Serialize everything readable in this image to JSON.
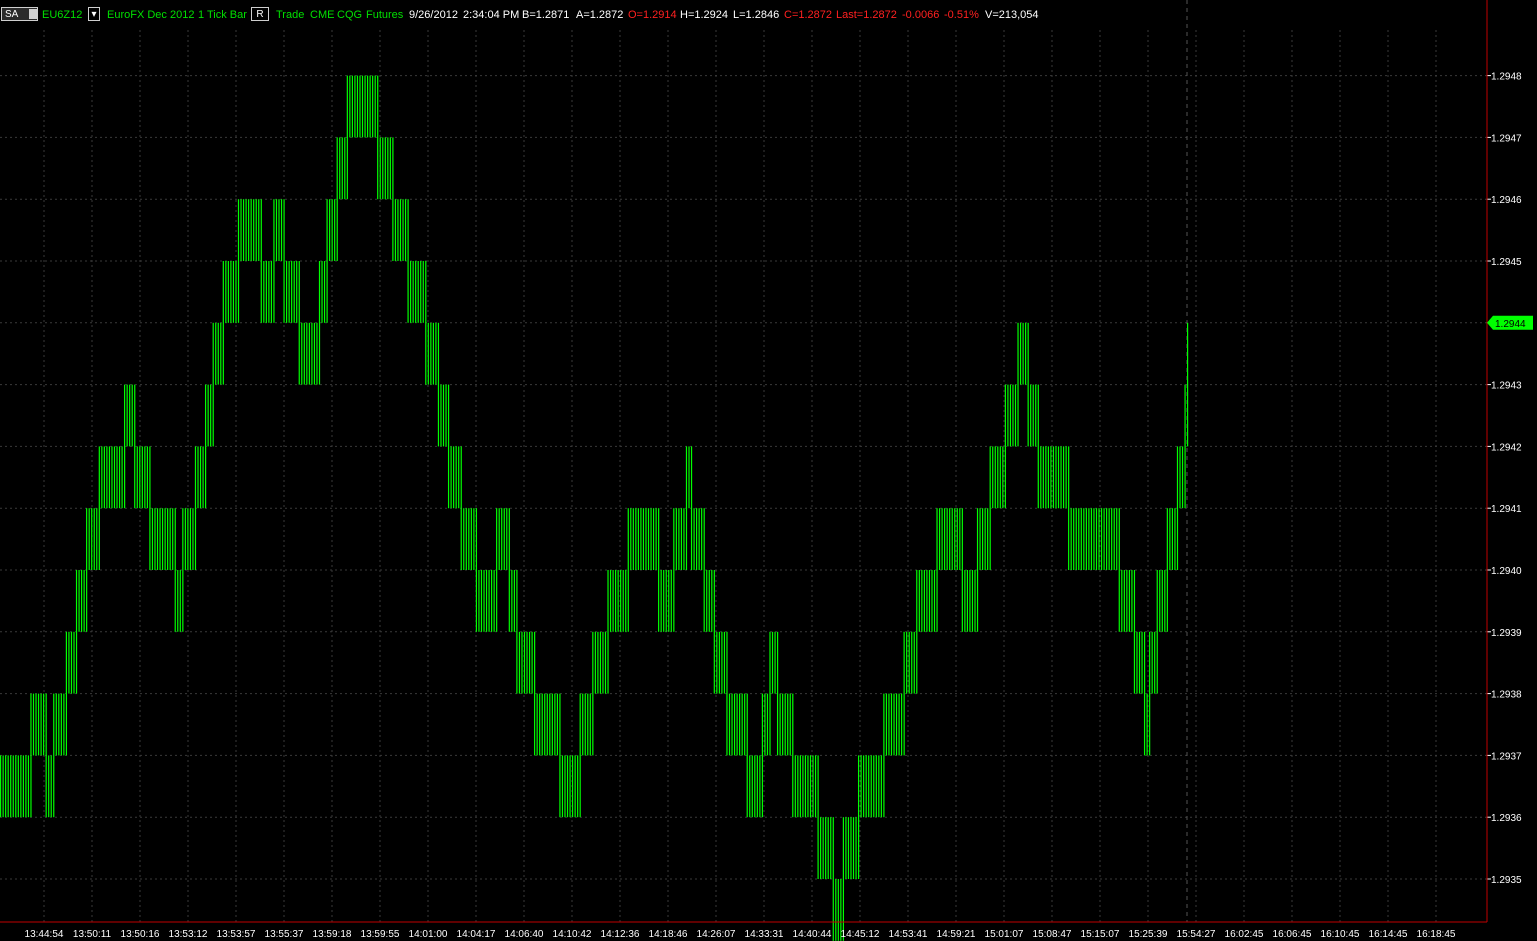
{
  "toolbar": {
    "source_box": "SA",
    "symbol": "EU6Z12",
    "description": "EuroFX Dec 2012",
    "bar_type": "1 Tick Bar",
    "mode_box": "R",
    "type": "Trade",
    "exchange": "CME",
    "feed": "CQG",
    "category": "Futures",
    "date": "9/26/2012",
    "time": "2:34:04 PM",
    "bid": "B=1.2871",
    "ask": "A=1.2872",
    "open": "O=1.2914",
    "high": "H=1.2924",
    "low": "L=1.2846",
    "close": "C=1.2872",
    "last": "Last=1.2872",
    "change": "-0.0066",
    "change_pct": "-0.51%",
    "volume": "V=213,054"
  },
  "colors": {
    "background": "#000000",
    "bars": "#00ff00",
    "grid": "#3a3a3a",
    "axis_text": "#ffffff",
    "axis_border": "#c00000",
    "last_price_tag": "#00ff00",
    "negative": "#ff2020",
    "label": "#00e000"
  },
  "chart_data": {
    "type": "bar",
    "title": "",
    "ylim": [
      1.29345,
      1.29491
    ],
    "ytick_labels": [
      "1.2935",
      "1.2936",
      "1.2937",
      "1.2938",
      "1.2939",
      "1.2940",
      "1.2941",
      "1.2942",
      "1.2943",
      "1.2944",
      "1.2945",
      "1.2946",
      "1.2947",
      "1.2948"
    ],
    "last_price_label": "1.2944",
    "x_tick_labels": [
      "13:44:54",
      "13:50:11",
      "13:50:16",
      "13:53:12",
      "13:53:57",
      "13:55:37",
      "13:59:18",
      "13:59:55",
      "14:01:00",
      "14:04:17",
      "14:06:40",
      "14:10:42",
      "14:12:36",
      "14:18:46",
      "14:26:07",
      "14:33:31",
      "14:40:44",
      "14:45:12",
      "14:53:41",
      "14:59:21",
      "15:01:07",
      "15:08:47",
      "15:15:07",
      "15:25:39",
      "15:54:27",
      "16:02:45",
      "16:06:45",
      "16:10:45",
      "16:14:45",
      "16:18:45"
    ],
    "grid": true,
    "bar_count": 470,
    "path_ticks": [
      {
        "p": 1.2937,
        "n": 12
      },
      {
        "p": 1.2938,
        "n": 6
      },
      {
        "p": 1.2937,
        "n": 3
      },
      {
        "p": 1.2938,
        "n": 5
      },
      {
        "p": 1.2939,
        "n": 4
      },
      {
        "p": 1.294,
        "n": 4
      },
      {
        "p": 1.2941,
        "n": 5
      },
      {
        "p": 1.2942,
        "n": 10
      },
      {
        "p": 1.2943,
        "n": 4
      },
      {
        "p": 1.2942,
        "n": 6
      },
      {
        "p": 1.2941,
        "n": 10
      },
      {
        "p": 1.294,
        "n": 3
      },
      {
        "p": 1.2941,
        "n": 5
      },
      {
        "p": 1.2942,
        "n": 4
      },
      {
        "p": 1.2943,
        "n": 3
      },
      {
        "p": 1.2944,
        "n": 4
      },
      {
        "p": 1.2945,
        "n": 6
      },
      {
        "p": 1.2946,
        "n": 9
      },
      {
        "p": 1.2945,
        "n": 5
      },
      {
        "p": 1.2946,
        "n": 4
      },
      {
        "p": 1.2945,
        "n": 6
      },
      {
        "p": 1.2944,
        "n": 8
      },
      {
        "p": 1.2945,
        "n": 3
      },
      {
        "p": 1.2946,
        "n": 4
      },
      {
        "p": 1.2947,
        "n": 4
      },
      {
        "p": 1.2948,
        "n": 12
      },
      {
        "p": 1.2947,
        "n": 6
      },
      {
        "p": 1.2946,
        "n": 6
      },
      {
        "p": 1.2945,
        "n": 7
      },
      {
        "p": 1.2944,
        "n": 5
      },
      {
        "p": 1.2943,
        "n": 4
      },
      {
        "p": 1.2942,
        "n": 5
      },
      {
        "p": 1.2941,
        "n": 6
      },
      {
        "p": 1.294,
        "n": 8
      },
      {
        "p": 1.2941,
        "n": 5
      },
      {
        "p": 1.294,
        "n": 3
      },
      {
        "p": 1.2939,
        "n": 7
      },
      {
        "p": 1.2938,
        "n": 10
      },
      {
        "p": 1.2937,
        "n": 8
      },
      {
        "p": 1.2938,
        "n": 5
      },
      {
        "p": 1.2939,
        "n": 6
      },
      {
        "p": 1.294,
        "n": 8
      },
      {
        "p": 1.2941,
        "n": 12
      },
      {
        "p": 1.294,
        "n": 6
      },
      {
        "p": 1.2941,
        "n": 5
      },
      {
        "p": 1.2942,
        "n": 2
      },
      {
        "p": 1.2941,
        "n": 5
      },
      {
        "p": 1.294,
        "n": 4
      },
      {
        "p": 1.2939,
        "n": 5
      },
      {
        "p": 1.2938,
        "n": 8
      },
      {
        "p": 1.2937,
        "n": 6
      },
      {
        "p": 1.2938,
        "n": 3
      },
      {
        "p": 1.2939,
        "n": 3
      },
      {
        "p": 1.2938,
        "n": 6
      },
      {
        "p": 1.2937,
        "n": 10
      },
      {
        "p": 1.2936,
        "n": 6
      },
      {
        "p": 1.2935,
        "n": 4
      },
      {
        "p": 1.2936,
        "n": 6
      },
      {
        "p": 1.2937,
        "n": 10
      },
      {
        "p": 1.2938,
        "n": 8
      },
      {
        "p": 1.2939,
        "n": 5
      },
      {
        "p": 1.294,
        "n": 8
      },
      {
        "p": 1.2941,
        "n": 10
      },
      {
        "p": 1.294,
        "n": 6
      },
      {
        "p": 1.2941,
        "n": 5
      },
      {
        "p": 1.2942,
        "n": 6
      },
      {
        "p": 1.2943,
        "n": 5
      },
      {
        "p": 1.2944,
        "n": 4
      },
      {
        "p": 1.2943,
        "n": 4
      },
      {
        "p": 1.2942,
        "n": 12
      },
      {
        "p": 1.2941,
        "n": 20
      },
      {
        "p": 1.294,
        "n": 6
      },
      {
        "p": 1.2939,
        "n": 4
      },
      {
        "p": 1.2938,
        "n": 2
      },
      {
        "p": 1.2939,
        "n": 3
      },
      {
        "p": 1.294,
        "n": 4
      },
      {
        "p": 1.2941,
        "n": 4
      },
      {
        "p": 1.2942,
        "n": 3
      },
      {
        "p": 1.2943,
        "n": 1
      },
      {
        "p": 1.2944,
        "n": 1
      }
    ]
  }
}
